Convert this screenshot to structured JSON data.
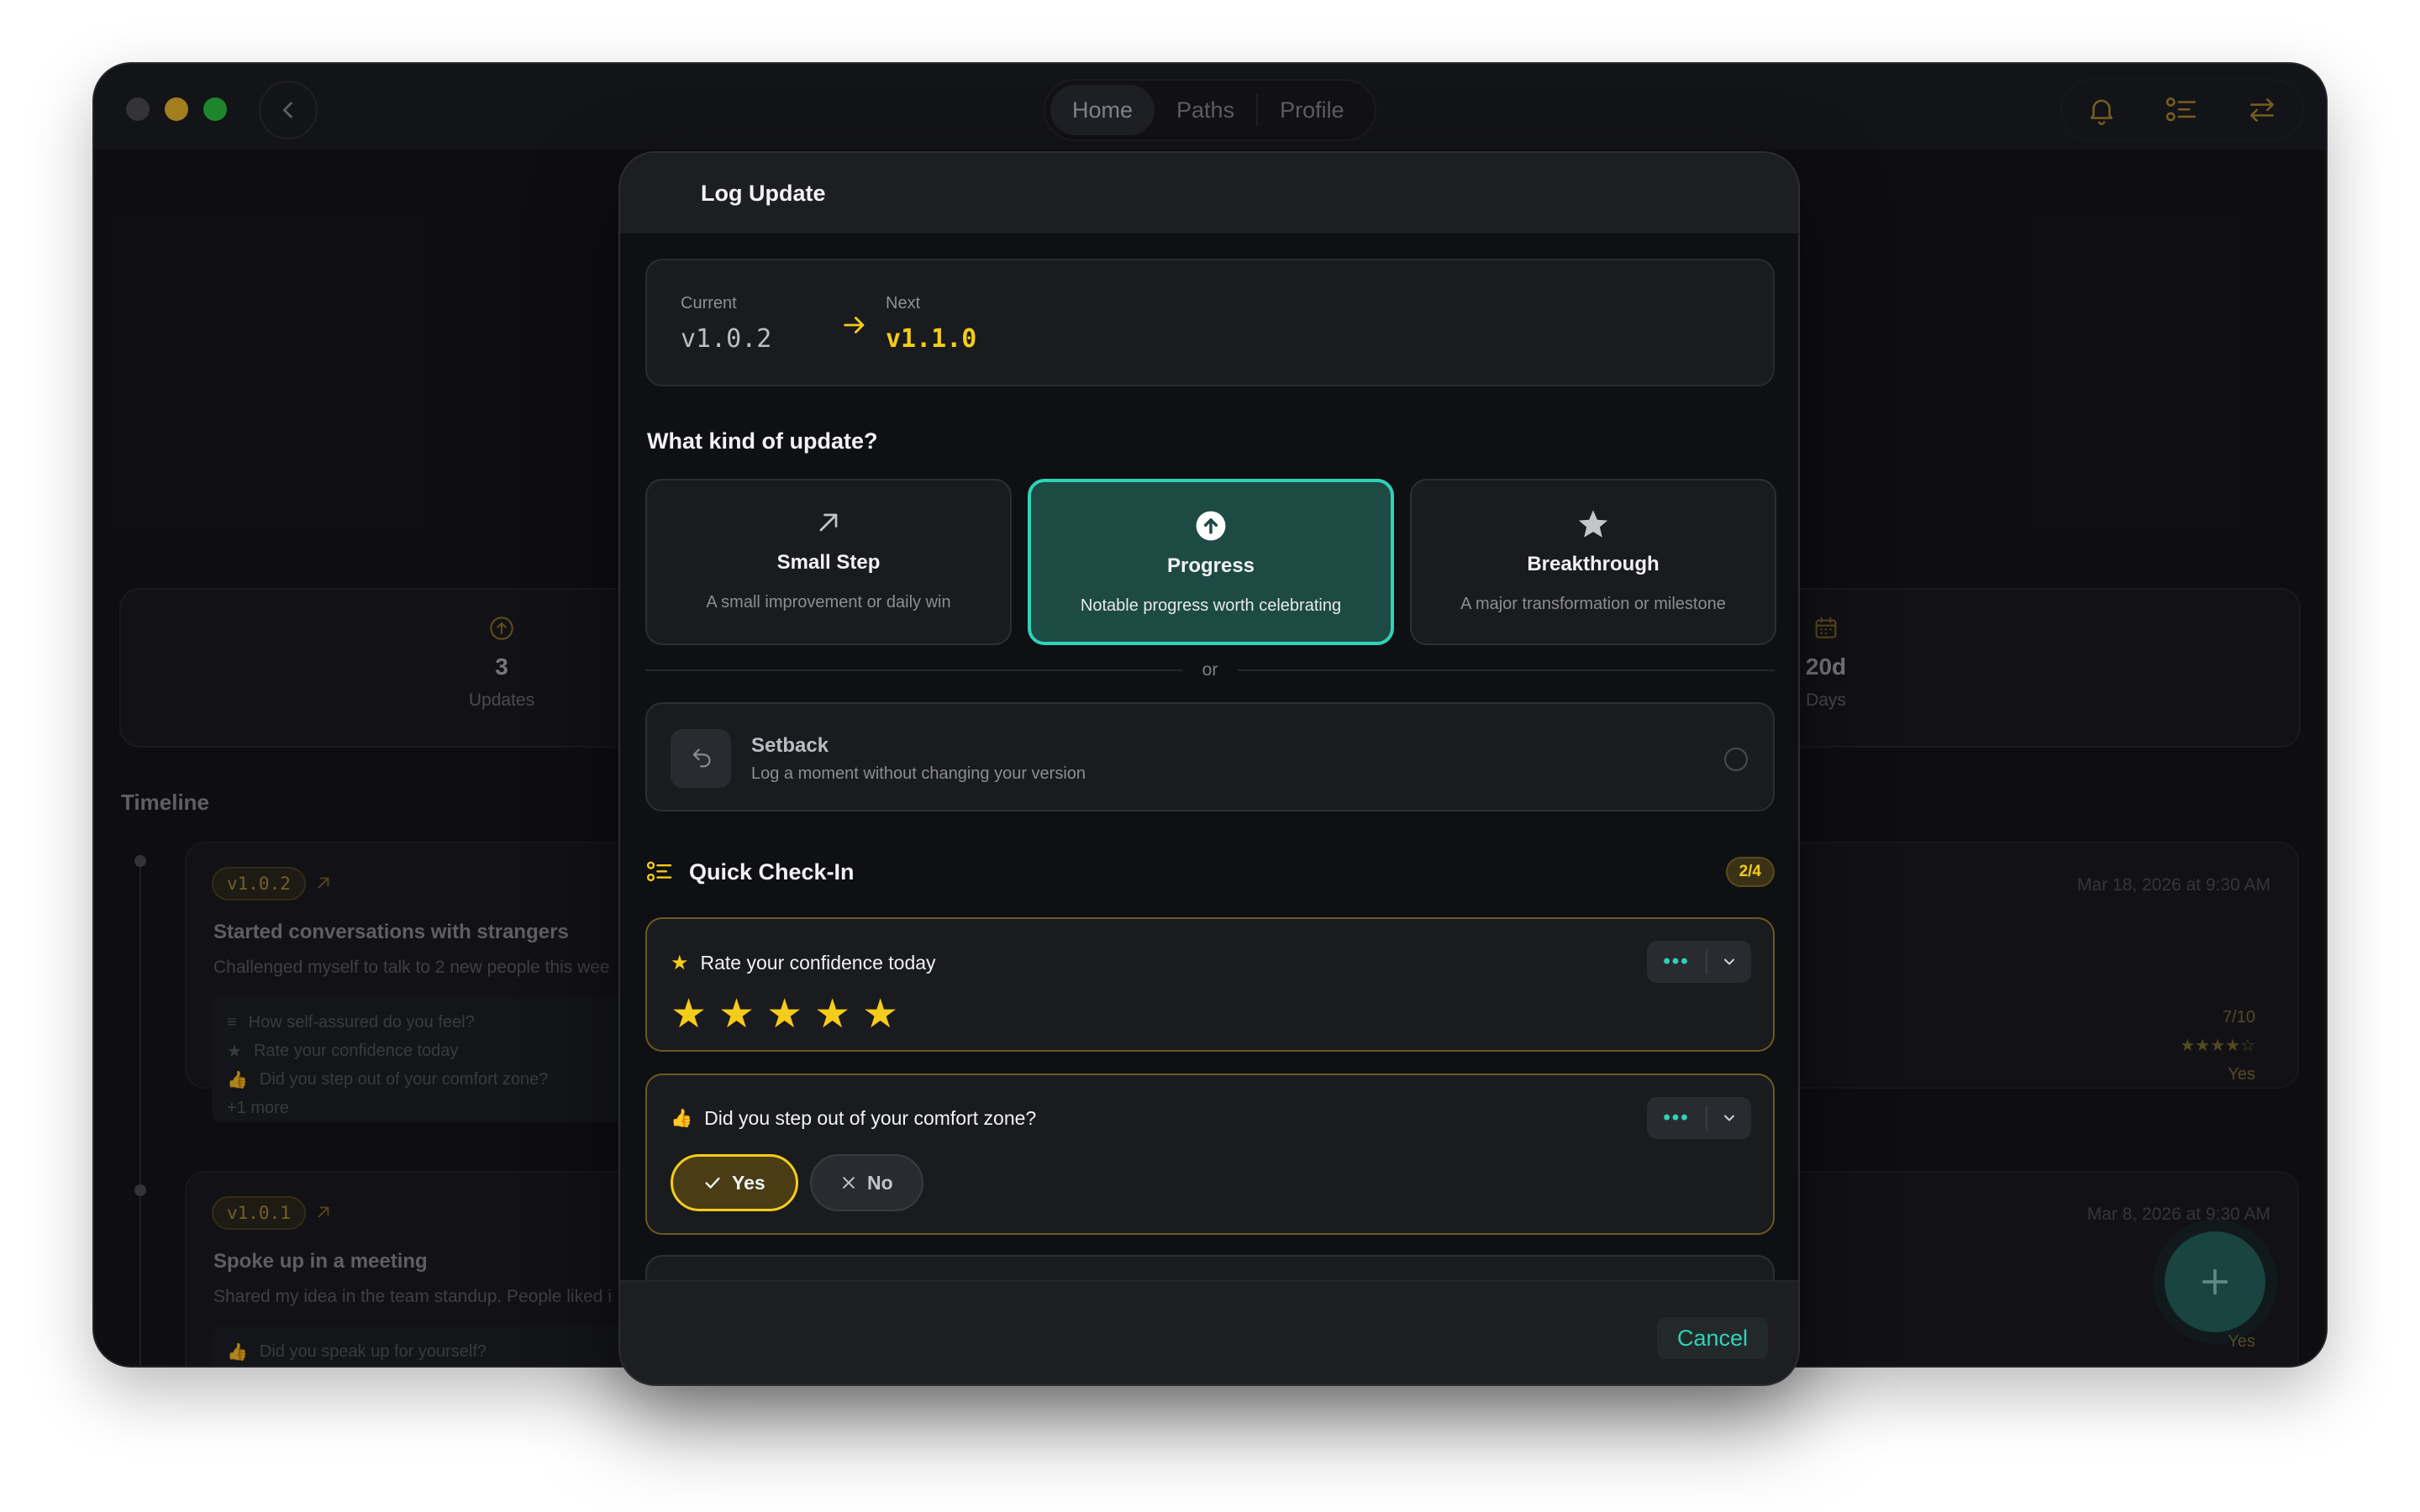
{
  "window": {
    "nav": {
      "tabs": [
        {
          "label": "Home",
          "active": true
        },
        {
          "label": "Paths",
          "active": false
        },
        {
          "label": "Profile",
          "active": false
        }
      ]
    },
    "toolbar_icons": [
      "bell-icon",
      "checklist-icon",
      "swap-icon"
    ]
  },
  "background": {
    "stats": {
      "updates": {
        "value": "3",
        "label": "Updates",
        "icon": "arrow-up-circle-icon"
      },
      "days": {
        "value": "20d",
        "label": "Days",
        "icon": "calendar-icon"
      }
    },
    "timeline_title": "Timeline",
    "entries": [
      {
        "version": "v1.0.2",
        "title": "Started conversations with strangers",
        "description": "Challenged myself to talk to 2 new people this wee",
        "date": "Mar 18, 2026 at 9:30 AM",
        "questions": [
          "How self-assured do you feel?",
          "Rate your confidence today",
          "Did you step out of your comfort zone?"
        ],
        "more": "+1 more",
        "values": [
          "7/10",
          "★★★★☆",
          "Yes"
        ]
      },
      {
        "version": "v1.0.1",
        "title": "Spoke up in a meeting",
        "description": "Shared my idea in the team standup. People liked i",
        "date": "Mar 8, 2026 at 9:30 AM",
        "questions": [
          "Did you speak up for yourself?"
        ],
        "values": [
          "Yes"
        ]
      }
    ],
    "fab_label": "+"
  },
  "modal": {
    "title": "Log Update",
    "current_label": "Current",
    "current_version": "v1.0.2",
    "next_label": "Next",
    "next_version": "v1.1.0",
    "question": "What kind of update?",
    "types": [
      {
        "title": "Small Step",
        "desc": "A small improvement or daily win",
        "icon": "arrow-up-right-icon",
        "selected": false
      },
      {
        "title": "Progress",
        "desc": "Notable progress worth celebrating",
        "icon": "arrow-up-circle-icon",
        "selected": true
      },
      {
        "title": "Breakthrough",
        "desc": "A major transformation or milestone",
        "icon": "star-icon",
        "selected": false
      }
    ],
    "or": "or",
    "setback": {
      "title": "Setback",
      "desc": "Log a moment without changing your version",
      "icon": "undo-icon"
    },
    "checkin": {
      "title": "Quick Check-In",
      "count": "2/4",
      "confidence": {
        "label": "Rate your confidence today",
        "rating": 5,
        "max": 5,
        "star": "★"
      },
      "comfort": {
        "label": "Did you step out of your comfort zone?",
        "yes": "Yes",
        "no": "No",
        "selected": "Yes"
      },
      "menu_dots": "•••"
    },
    "cancel": "Cancel"
  },
  "colors": {
    "accent_teal": "#2ed3b7",
    "accent_yellow": "#f5cc19",
    "window_bg": "#111215",
    "modal_bg": "#0f1013"
  }
}
